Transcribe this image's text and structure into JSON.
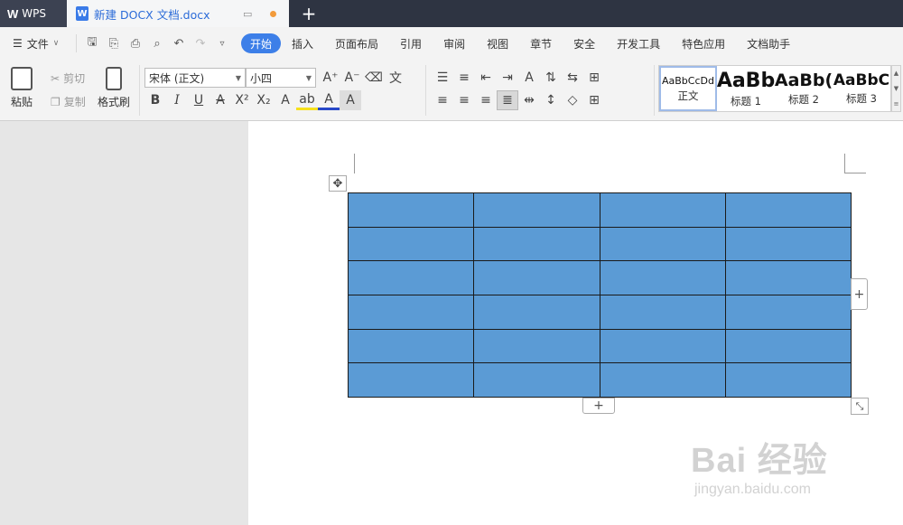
{
  "titlebar": {
    "app_name": "WPS",
    "doc_tab": "新建 DOCX 文档.docx",
    "new_tab": "+"
  },
  "menubar": {
    "file_label": "文件",
    "tabs": [
      "开始",
      "插入",
      "页面布局",
      "引用",
      "审阅",
      "视图",
      "章节",
      "安全",
      "开发工具",
      "特色应用",
      "文档助手"
    ],
    "active_tab": "开始"
  },
  "ribbon": {
    "paste": "粘贴",
    "cut": "剪切",
    "copy": "复制",
    "format_painter": "格式刷",
    "font_name": "宋体 (正文)",
    "font_size": "小四",
    "styles": [
      {
        "preview": "AaBbCcDd",
        "label": "正文"
      },
      {
        "preview": "AaBb",
        "label": "标题 1"
      },
      {
        "preview": "AaBb(",
        "label": "标题 2"
      },
      {
        "preview": "AaBbC",
        "label": "标题 3"
      }
    ]
  },
  "table": {
    "rows": 6,
    "cols": 4,
    "fill_color": "#5b9bd5",
    "border_color": "#1a1a1a"
  },
  "controls": {
    "add_symbol": "+"
  },
  "watermark": {
    "line1": "Bai  经验",
    "line2": "jingyan.baidu.com"
  },
  "colors": {
    "accent": "#3d7fe8",
    "titlebar": "#2e3442"
  }
}
